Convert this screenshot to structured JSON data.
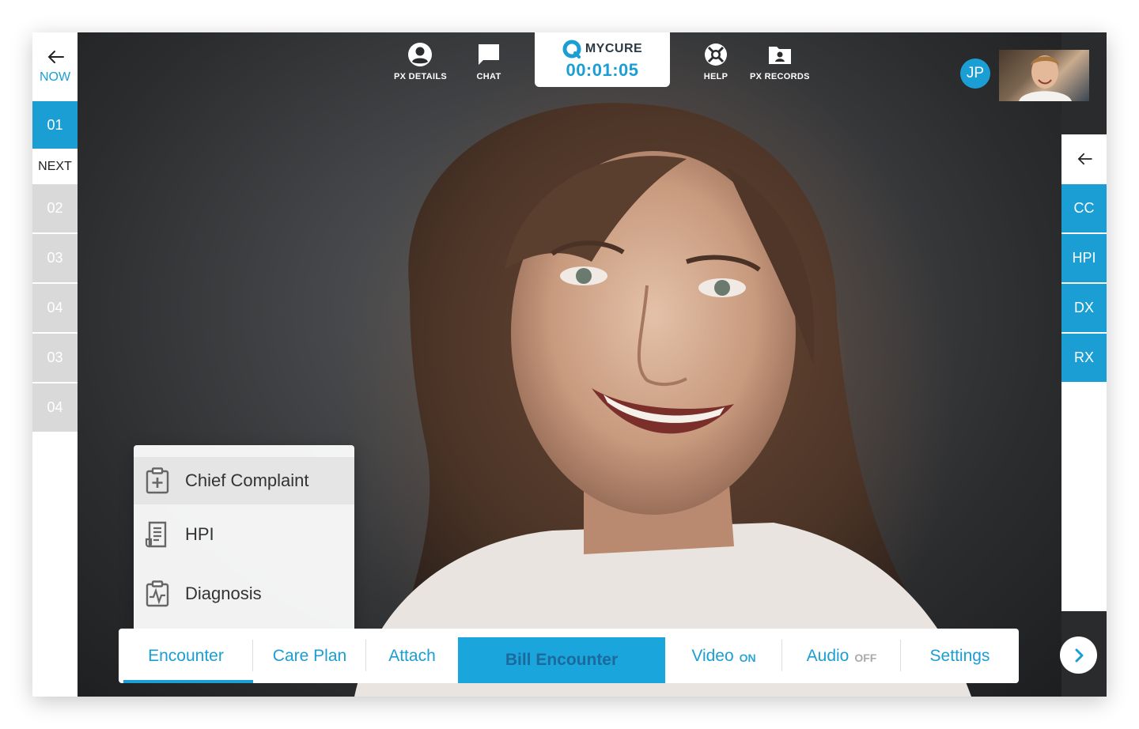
{
  "queue": {
    "now_label": "NOW",
    "current": "01",
    "next_label": "NEXT",
    "items": [
      "02",
      "03",
      "04",
      "03",
      "04"
    ]
  },
  "toolbar": {
    "px_details": "PX DETAILS",
    "chat": "CHAT",
    "help": "HELP",
    "px_records": "PX RECORDS"
  },
  "brand": {
    "name": "MYCURE",
    "timer": "00:01:05"
  },
  "user": {
    "initials": "JP"
  },
  "quick_menu": [
    "CC",
    "HPI",
    "DX",
    "RX"
  ],
  "encounter_menu": [
    {
      "label": "Chief Complaint",
      "icon": "clipboard-plus-icon"
    },
    {
      "label": "HPI",
      "icon": "document-list-icon"
    },
    {
      "label": "Diagnosis",
      "icon": "clipboard-pulse-icon"
    }
  ],
  "tabs": {
    "encounter": "Encounter",
    "care_plan": "Care Plan",
    "attach": "Attach",
    "bill": "Bill Encounter",
    "video": "Video",
    "video_state": "ON",
    "audio": "Audio",
    "audio_state": "OFF",
    "settings": "Settings"
  },
  "colors": {
    "accent": "#1a9ed4",
    "queue_inactive": "#d9d9d9",
    "bill_button": "#1aa5dc"
  }
}
